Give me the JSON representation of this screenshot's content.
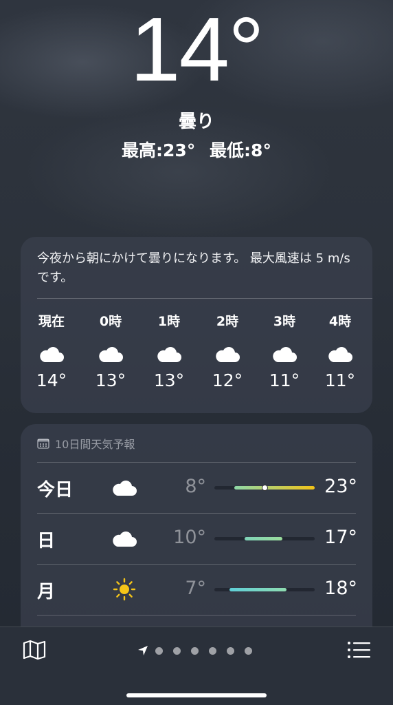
{
  "current": {
    "temperature": "14°",
    "condition": "曇り",
    "high": "最高:23°",
    "low": "最低:8°"
  },
  "hourly": {
    "summary": "今夜から朝にかけて曇りになります。 最大風速は 5 m/s です。",
    "items": [
      {
        "label": "現在",
        "icon": "cloud-icon",
        "temp": "14°"
      },
      {
        "label": "0時",
        "icon": "cloud-icon",
        "temp": "13°"
      },
      {
        "label": "1時",
        "icon": "cloud-icon",
        "temp": "13°"
      },
      {
        "label": "2時",
        "icon": "cloud-icon",
        "temp": "12°"
      },
      {
        "label": "3時",
        "icon": "cloud-icon",
        "temp": "11°"
      },
      {
        "label": "4時",
        "icon": "cloud-icon",
        "temp": "11°"
      }
    ]
  },
  "forecast": {
    "header": "10日間天気予報",
    "header_icon": "calendar-icon",
    "days": [
      {
        "day": "今日",
        "icon": "cloud-icon",
        "low": "8°",
        "high": "23°",
        "range_start": 0.2,
        "range_end": 1.0,
        "current_marker": 0.5,
        "colors": [
          "#8ed8a8",
          "#f2c318"
        ]
      },
      {
        "day": "日",
        "icon": "cloud-icon",
        "low": "10°",
        "high": "17°",
        "range_start": 0.3,
        "range_end": 0.68,
        "colors": [
          "#7fd3b8",
          "#9bdc9c"
        ]
      },
      {
        "day": "月",
        "icon": "sun-icon",
        "low": "7°",
        "high": "18°",
        "range_start": 0.15,
        "range_end": 0.72,
        "colors": [
          "#5fcfd8",
          "#8fdcb0"
        ]
      }
    ]
  },
  "toolbar": {
    "map_icon": "map-icon",
    "list_icon": "list-icon",
    "location_icon": "location-arrow-icon",
    "page_count": 6
  },
  "colors": {
    "accent_yellow": "#f2c318",
    "accent_green": "#8ed8a8",
    "card_bg": "#3a404d"
  }
}
